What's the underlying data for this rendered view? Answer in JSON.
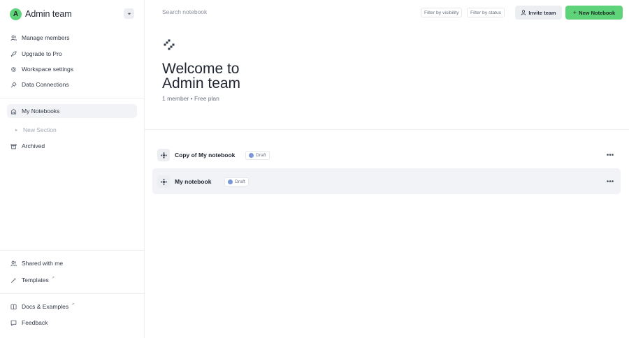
{
  "workspace": {
    "avatar_letter": "A",
    "name": "Admin team",
    "toggle_icon": "chevron-down-icon",
    "accent": "#5fd37a"
  },
  "sidebar": {
    "top_items": [
      {
        "label": "Manage members",
        "icon": "users-icon"
      },
      {
        "label": "Upgrade to Pro",
        "icon": "rocket-icon"
      },
      {
        "label": "Workspace settings",
        "icon": "gear-icon"
      },
      {
        "label": "Data Connections",
        "icon": "plug-icon"
      }
    ],
    "notebooks": {
      "label": "My Notebooks",
      "icon": "home-icon"
    },
    "new_section": {
      "label": "New Section",
      "icon": "bullet-icon"
    },
    "archived": {
      "label": "Archived",
      "icon": "archive-icon"
    },
    "bottom_items": [
      {
        "label": "Shared with me",
        "icon": "users-icon"
      },
      {
        "label": "Templates",
        "icon": "sparkle-icon",
        "external": "↗"
      }
    ],
    "help_items": [
      {
        "label": "Docs & Examples",
        "icon": "book-icon",
        "external": "↗"
      },
      {
        "label": "Feedback",
        "icon": "chat-icon"
      }
    ]
  },
  "topbar": {
    "search_placeholder": "Search notebook",
    "filters": [
      "Filter by visibility",
      "Filter by status"
    ],
    "invite_label": "Invite team",
    "new_label": "New Notebook"
  },
  "hero": {
    "title_line1": "Welcome to",
    "title_line2": "Admin team",
    "meta": "1 member • Free plan"
  },
  "notebooks": [
    {
      "title": "Copy of My notebook",
      "status": "Draft"
    },
    {
      "title": "My notebook",
      "status": "Draft"
    }
  ]
}
